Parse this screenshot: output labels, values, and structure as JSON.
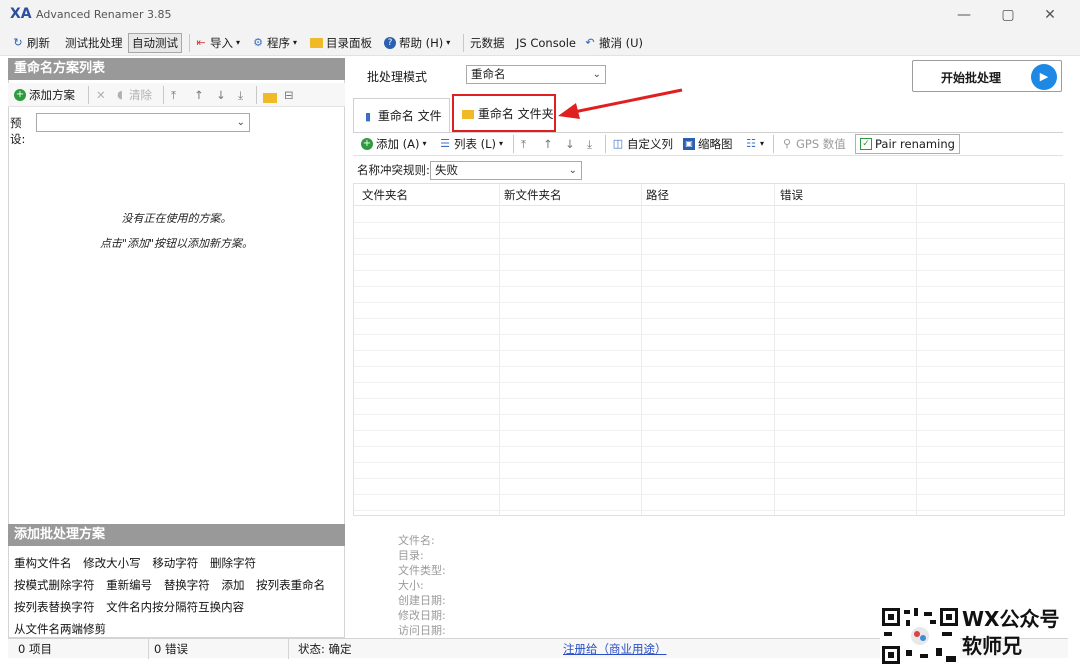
{
  "window": {
    "title": "Advanced Renamer 3.85",
    "app_icon": "XA",
    "min_icon": "—",
    "max_icon": "▢",
    "close_icon": "✕"
  },
  "toolbar": {
    "refresh": "刷新",
    "test_batch": "测试批处理",
    "auto_test": "自动测试",
    "import": "导入",
    "program": "程序",
    "dir_panel": "目录面板",
    "help": "帮助 (H)",
    "metadata": "元数据",
    "js_console": "JS Console",
    "undo": "撤消 (U)"
  },
  "left_panel": {
    "header": "重命名方案列表",
    "add_method": "添加方案",
    "clear": "清除",
    "preset_label": "预设:",
    "preset_value": "",
    "empty_line1": "没有正在使用的方案。",
    "empty_line2": "点击\"添加\"按钮以添加新方案。",
    "add_header": "添加批处理方案",
    "methods": [
      [
        "重构文件名",
        "修改大小写",
        "移动字符",
        "删除字符"
      ],
      [
        "按模式删除字符",
        "重新编号",
        "替换字符",
        "添加",
        "按列表重命名"
      ],
      [
        "按列表替换字符",
        "文件名内按分隔符互换内容"
      ],
      [
        "从文件名两端修剪"
      ]
    ]
  },
  "main": {
    "batch_mode_label": "批处理模式",
    "batch_mode_value": "重命名",
    "start_button": "开始批处理",
    "tab_files": "重命名 文件",
    "tab_folders": "重命名 文件夹",
    "add": "添加 (A)",
    "list": "列表 (L)",
    "custom_columns": "自定义列",
    "thumbnails": "缩略图",
    "gps": "GPS 数值",
    "pair_renaming": "Pair renaming",
    "conflict_label": "名称冲突规则:",
    "conflict_value": "失败",
    "columns": [
      "文件夹名",
      "新文件夹名",
      "路径",
      "错误"
    ]
  },
  "info": {
    "labels": [
      "文件名:",
      "目录:",
      "文件类型:",
      "大小:",
      "创建日期:",
      "修改日期:",
      "访问日期:"
    ]
  },
  "status": {
    "items": "0 项目",
    "errors": "0 错误",
    "state": "状态: 确定",
    "register": "注册给（商业用途）"
  },
  "watermark": {
    "line1": "WX公众号",
    "line2": "软师兄"
  }
}
